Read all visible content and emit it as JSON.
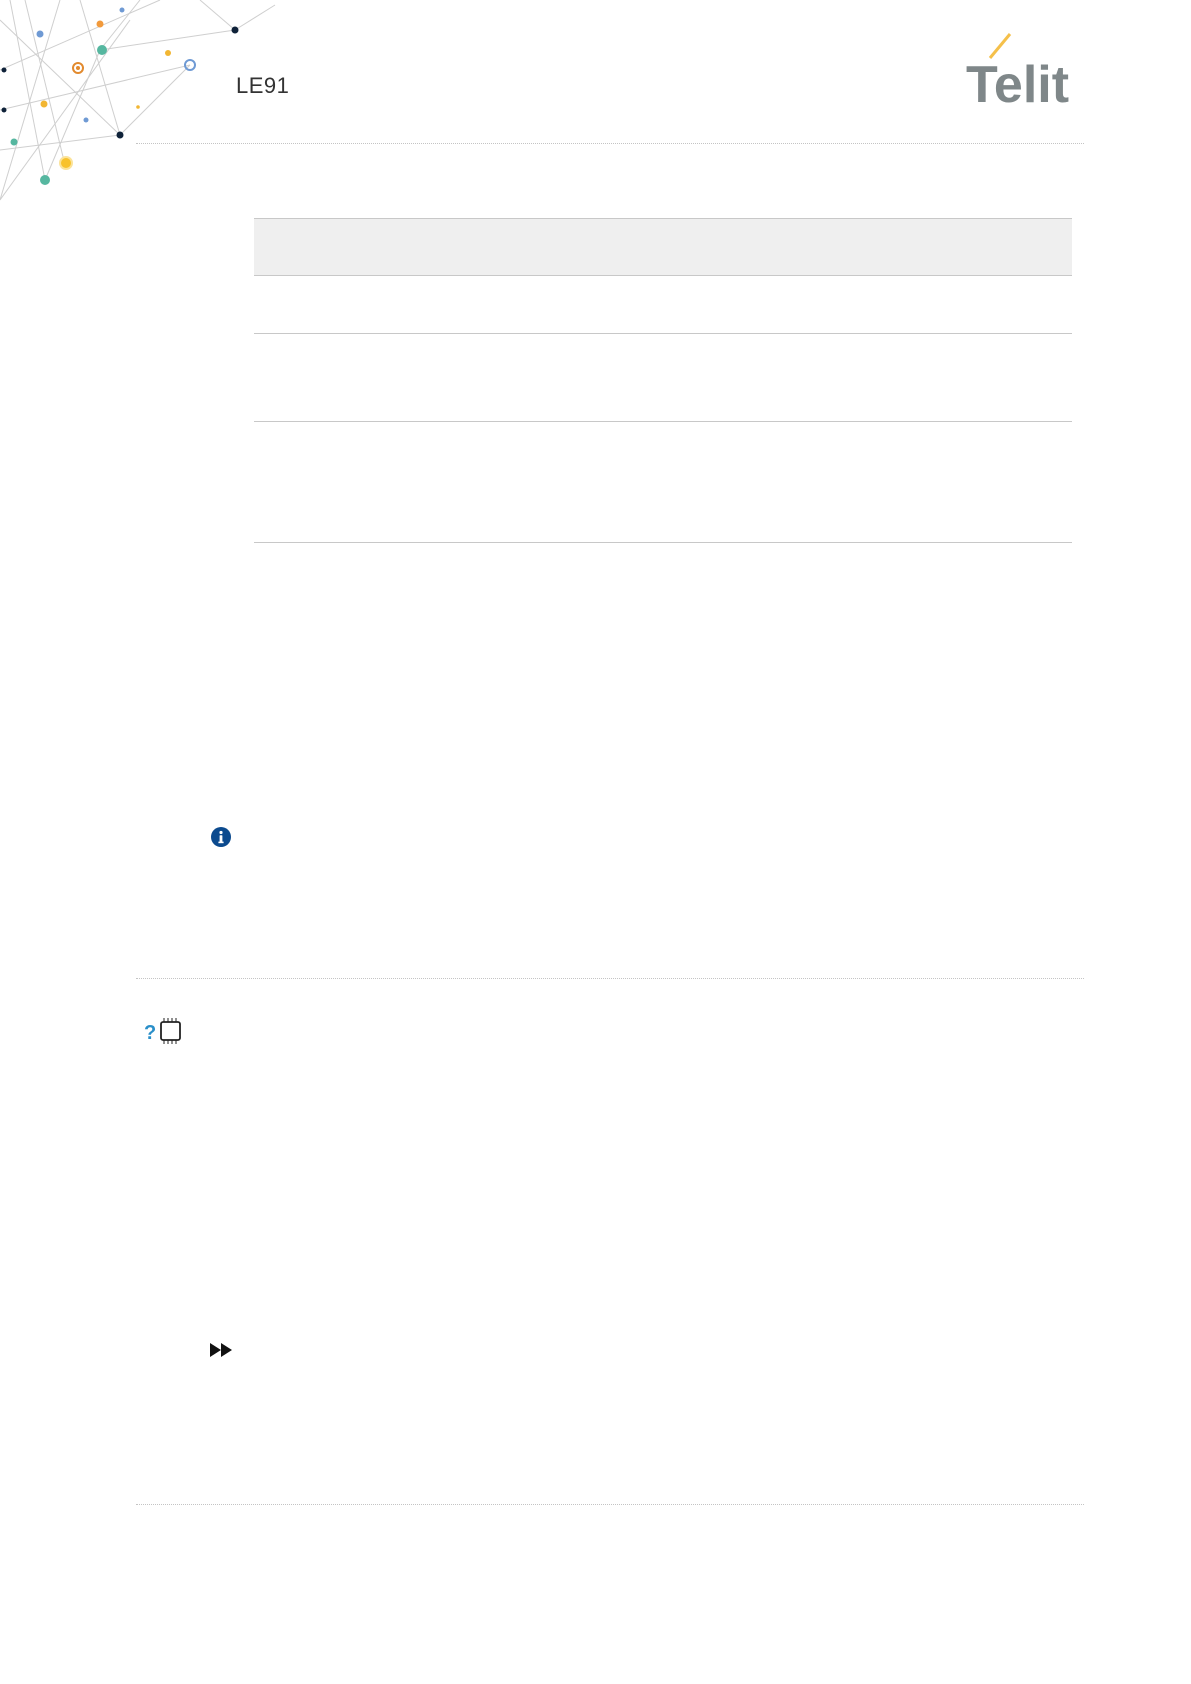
{
  "header": {
    "product_name": "LE91",
    "logo_text": "Telit",
    "logo_color": "#7f8789",
    "logo_accent_color": "#f5c04a"
  },
  "table": {
    "header_color": "#efefef",
    "rows": 3
  },
  "icons": {
    "decoration": "network-dots-decoration",
    "info": "info-circle-icon",
    "command": "help-chip-icon",
    "next": "fast-forward-icon"
  },
  "colors": {
    "info_icon": "#0b4a8e",
    "help_icon": "#2a8fc9",
    "rule": "#c4c4c4"
  }
}
